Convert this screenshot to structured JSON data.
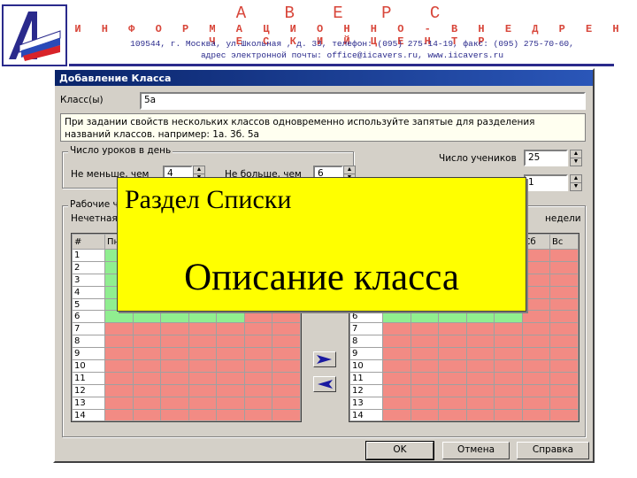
{
  "header": {
    "company": "А В Е Р С",
    "subtitle": "И Н Ф О Р М А Ц И О Н Н О - В Н Е Д Р Е Н Ч Е С К И Й   Ц Е Н Т Р",
    "address": "109544, г. Москва, ул.Школьная , д. 33,  телефон:  (095) 275-14-19, факс: (095) 275-70-60,",
    "email": "адрес электронной почты: office@iicavers.ru, www.iicavers.ru"
  },
  "dialog": {
    "title": "Добавление Класса",
    "class_label": "Класс(ы)",
    "class_value": "5а",
    "hint": "При задании свойств нескольких классов одновременно используйте запятые для разделения названий классов. например: 1а. 3б. 5а",
    "lessons_group": "Число уроков в день",
    "min_label": "Не меньше, чем",
    "min_value": "4",
    "max_label": "Не больше, чем",
    "max_value": "6",
    "students_label": "Число учеников",
    "students_value": "25",
    "second_value": "1",
    "work_group": "Рабочие ч",
    "left_caption": "Нечетная",
    "right_caption": "недели",
    "grid_left_headers": [
      "#",
      "Пн",
      "",
      "",
      "",
      "",
      "",
      ""
    ],
    "grid_right_headers": [
      "",
      "",
      "",
      "",
      "",
      "",
      "Сб",
      "Вс"
    ],
    "rows": [
      "1",
      "2",
      "3",
      "4",
      "5",
      "6",
      "7",
      "8",
      "9",
      "10",
      "11",
      "12",
      "13",
      "14"
    ],
    "ok": "OK",
    "cancel": "Отмена",
    "help": "Справка"
  },
  "overlay": {
    "line1": "Раздел Списки",
    "line2": "Описание класса"
  },
  "colors": {
    "blocked": "#f28b84",
    "free": "#90ee90",
    "overlay": "#ffff00"
  }
}
